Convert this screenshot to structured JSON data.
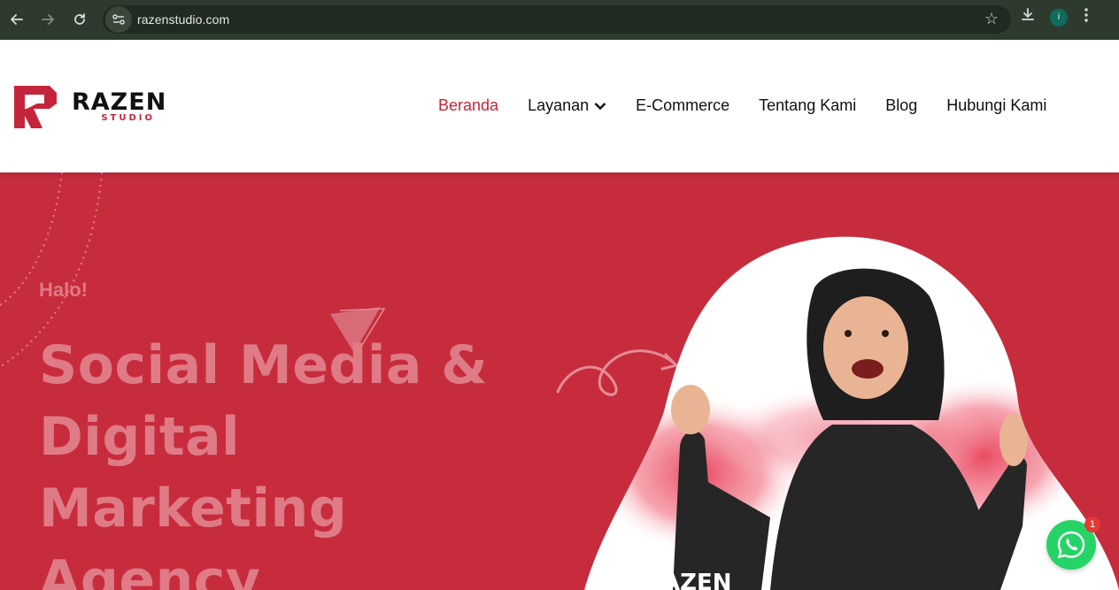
{
  "browser": {
    "url": "razenstudio.com",
    "profile_initial": "i"
  },
  "site": {
    "logo": {
      "name": "RAZEN",
      "sub": "STUDIO"
    },
    "nav": [
      {
        "label": "Beranda",
        "active": true
      },
      {
        "label": "Layanan",
        "has_dropdown": true
      },
      {
        "label": "E-Commerce"
      },
      {
        "label": "Tentang Kami"
      },
      {
        "label": "Blog"
      },
      {
        "label": "Hubungi Kami"
      }
    ]
  },
  "hero": {
    "greeting": "Halo!",
    "title_lines": [
      "Social Media &",
      "Digital",
      "Marketing",
      "Agency"
    ],
    "image_caption": "RAZEN"
  },
  "whatsapp": {
    "badge_count": "1"
  },
  "colors": {
    "brand_red": "#c4253a",
    "hero_bg": "#c72c3d",
    "hero_text": "#df7b86",
    "whatsapp": "#25d366"
  }
}
